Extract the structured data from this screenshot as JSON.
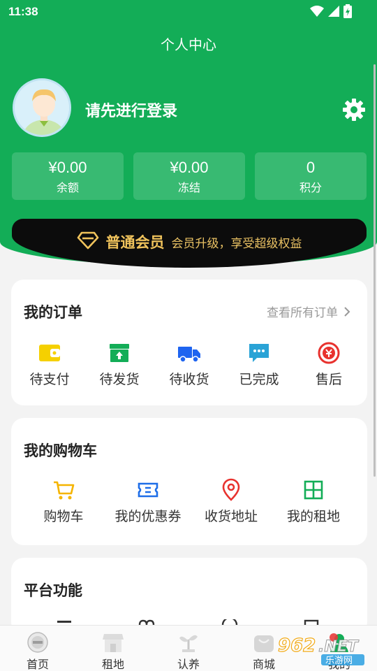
{
  "status": {
    "time": "11:38"
  },
  "header": {
    "title": "个人中心"
  },
  "user": {
    "login_prompt": "请先进行登录"
  },
  "stats": [
    {
      "value": "¥0.00",
      "label": "余额"
    },
    {
      "value": "¥0.00",
      "label": "冻结"
    },
    {
      "value": "0",
      "label": "积分"
    }
  ],
  "member": {
    "tier": "普通会员",
    "desc": "会员升级，享受超级权益"
  },
  "orders": {
    "title": "我的订单",
    "view_all": "查看所有订单",
    "items": [
      {
        "label": "待支付",
        "icon": "wallet-icon",
        "color": "#f5d000"
      },
      {
        "label": "待发货",
        "icon": "package-icon",
        "color": "#13ad57"
      },
      {
        "label": "待收货",
        "icon": "truck-icon",
        "color": "#1e64f0"
      },
      {
        "label": "已完成",
        "icon": "chat-icon",
        "color": "#2aa3d6"
      },
      {
        "label": "售后",
        "icon": "after-sale-icon",
        "color": "#e8322e"
      }
    ]
  },
  "cart": {
    "title": "我的购物车",
    "items": [
      {
        "label": "购物车",
        "icon": "cart-icon",
        "color": "#f5b400"
      },
      {
        "label": "我的优惠券",
        "icon": "coupon-icon",
        "color": "#1e6ee8"
      },
      {
        "label": "收货地址",
        "icon": "location-icon",
        "color": "#e8322e"
      },
      {
        "label": "我的租地",
        "icon": "grid-icon",
        "color": "#13ad57"
      }
    ]
  },
  "platform": {
    "title": "平台功能"
  },
  "tabbar": [
    {
      "label": "首页",
      "icon": "home-icon"
    },
    {
      "label": "租地",
      "icon": "store-icon"
    },
    {
      "label": "认养",
      "icon": "plant-icon"
    },
    {
      "label": "商城",
      "icon": "mall-icon"
    },
    {
      "label": "我的",
      "icon": "profile-icon"
    }
  ],
  "watermark": {
    "text": "962.NET",
    "subtext": "乐游网"
  },
  "colors": {
    "primary": "#13ad57",
    "gold": "#f0c35c",
    "black_bar": "#0c0c0c"
  }
}
